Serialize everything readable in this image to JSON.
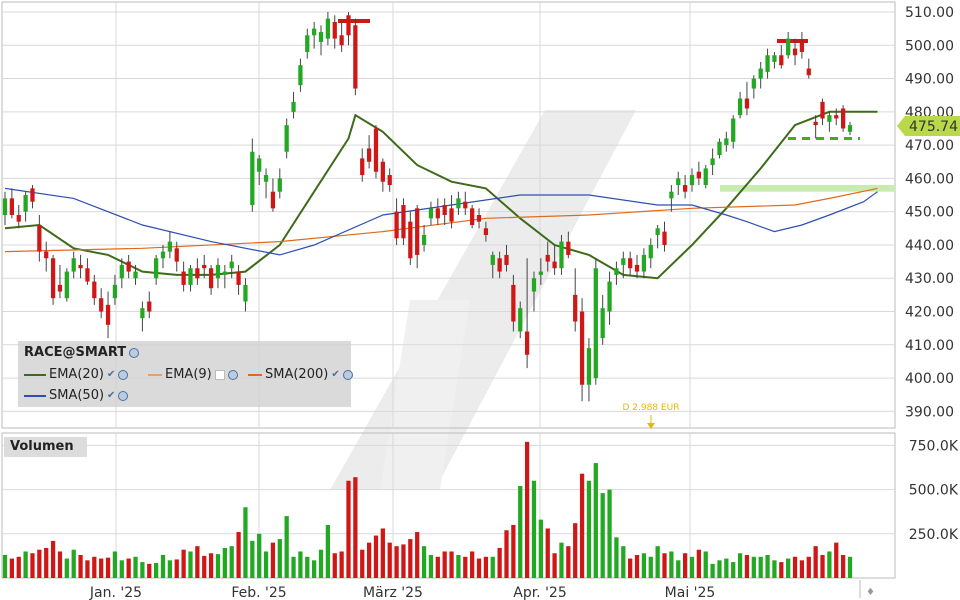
{
  "legend": {
    "title": "RACE@SMART",
    "items": [
      {
        "label": "EMA(20)",
        "color": "#3d6b1a"
      },
      {
        "label": "EMA(9)",
        "color": "#e0843a"
      },
      {
        "label": "SMA(200)",
        "color": "#e0843a"
      },
      {
        "label": "SMA(50)",
        "color": "#2f4fb0"
      }
    ]
  },
  "volume_panel": {
    "label": "Volumen"
  },
  "annotation": {
    "dividend": "D 2.988 EUR"
  },
  "last_price": "475.74",
  "colors": {
    "up": "#22a822",
    "down": "#d01717",
    "ema20": "#3d6b1a",
    "sma200": "#e06a1a",
    "sma50": "#2f4fb0",
    "grid": "#d9d9d9",
    "highlight": "#c8ecb0",
    "last_price_bg": "#b9d84a"
  },
  "chart_data": [
    {
      "type": "candlestick",
      "title": "RACE@SMART",
      "x_tick_labels": [
        "Jan. '25",
        "Feb. '25",
        "März '25",
        "Apr. '25",
        "Mai '25"
      ],
      "y_tick_labels": [
        "510.00",
        "500.00",
        "490.00",
        "480.00",
        "470.00",
        "460.00",
        "450.00",
        "440.00",
        "430.00",
        "420.00",
        "410.00",
        "400.00",
        "390.00"
      ],
      "ylim": [
        385,
        513
      ],
      "grid": true,
      "last_price": 475.74,
      "candles": [
        {
          "o": 449,
          "h": 456,
          "l": 446,
          "c": 454
        },
        {
          "o": 454,
          "h": 457,
          "l": 448,
          "c": 449
        },
        {
          "o": 449,
          "h": 452,
          "l": 445,
          "c": 447
        },
        {
          "o": 450,
          "h": 456,
          "l": 447,
          "c": 455
        },
        {
          "o": 457,
          "h": 458,
          "l": 451,
          "c": 453
        },
        {
          "o": 446,
          "h": 449,
          "l": 435,
          "c": 438
        },
        {
          "o": 438,
          "h": 441,
          "l": 432,
          "c": 436
        },
        {
          "o": 436,
          "h": 437,
          "l": 422,
          "c": 424
        },
        {
          "o": 428,
          "h": 434,
          "l": 424,
          "c": 426
        },
        {
          "o": 424,
          "h": 433,
          "l": 423,
          "c": 432
        },
        {
          "o": 432,
          "h": 438,
          "l": 430,
          "c": 436
        },
        {
          "o": 434,
          "h": 437,
          "l": 430,
          "c": 433
        },
        {
          "o": 433,
          "h": 436,
          "l": 428,
          "c": 429
        },
        {
          "o": 429,
          "h": 431,
          "l": 422,
          "c": 424
        },
        {
          "o": 424,
          "h": 427,
          "l": 418,
          "c": 420
        },
        {
          "o": 422,
          "h": 426,
          "l": 412,
          "c": 416
        },
        {
          "o": 424,
          "h": 431,
          "l": 422,
          "c": 428
        },
        {
          "o": 430,
          "h": 436,
          "l": 427,
          "c": 434
        },
        {
          "o": 435,
          "h": 437,
          "l": 430,
          "c": 432
        },
        {
          "o": 430,
          "h": 434,
          "l": 428,
          "c": 432
        },
        {
          "o": 418,
          "h": 423,
          "l": 414,
          "c": 421
        },
        {
          "o": 423,
          "h": 426,
          "l": 418,
          "c": 420
        },
        {
          "o": 430,
          "h": 437,
          "l": 428,
          "c": 436
        },
        {
          "o": 436,
          "h": 440,
          "l": 433,
          "c": 438
        },
        {
          "o": 438,
          "h": 444,
          "l": 436,
          "c": 441
        },
        {
          "o": 439,
          "h": 441,
          "l": 432,
          "c": 435
        },
        {
          "o": 432,
          "h": 435,
          "l": 426,
          "c": 428
        },
        {
          "o": 428,
          "h": 434,
          "l": 426,
          "c": 433
        },
        {
          "o": 433,
          "h": 436,
          "l": 428,
          "c": 430
        },
        {
          "o": 434,
          "h": 437,
          "l": 430,
          "c": 433
        },
        {
          "o": 433,
          "h": 434,
          "l": 425,
          "c": 427
        },
        {
          "o": 430,
          "h": 436,
          "l": 427,
          "c": 434
        },
        {
          "o": 431,
          "h": 434,
          "l": 427,
          "c": 432
        },
        {
          "o": 433,
          "h": 437,
          "l": 430,
          "c": 435
        },
        {
          "o": 432,
          "h": 434,
          "l": 425,
          "c": 428
        },
        {
          "o": 423,
          "h": 430,
          "l": 420,
          "c": 428
        },
        {
          "o": 452,
          "h": 472,
          "l": 450,
          "c": 468
        },
        {
          "o": 462,
          "h": 467,
          "l": 458,
          "c": 466
        },
        {
          "o": 459,
          "h": 463,
          "l": 454,
          "c": 461
        },
        {
          "o": 456,
          "h": 460,
          "l": 450,
          "c": 451
        },
        {
          "o": 456,
          "h": 463,
          "l": 454,
          "c": 460
        },
        {
          "o": 468,
          "h": 478,
          "l": 466,
          "c": 476
        },
        {
          "o": 480,
          "h": 486,
          "l": 478,
          "c": 483
        },
        {
          "o": 488,
          "h": 496,
          "l": 486,
          "c": 494
        },
        {
          "o": 498,
          "h": 505,
          "l": 496,
          "c": 503
        },
        {
          "o": 503,
          "h": 507,
          "l": 499,
          "c": 505
        },
        {
          "o": 501,
          "h": 506,
          "l": 497,
          "c": 504
        },
        {
          "o": 502,
          "h": 510,
          "l": 500,
          "c": 508
        },
        {
          "o": 507,
          "h": 509,
          "l": 499,
          "c": 502
        },
        {
          "o": 503,
          "h": 507,
          "l": 498,
          "c": 500
        },
        {
          "o": 509,
          "h": 510,
          "l": 500,
          "c": 503
        },
        {
          "o": 506,
          "h": 508,
          "l": 485,
          "c": 487
        },
        {
          "o": 466,
          "h": 469,
          "l": 459,
          "c": 461
        },
        {
          "o": 469,
          "h": 473,
          "l": 463,
          "c": 465
        },
        {
          "o": 475,
          "h": 476,
          "l": 460,
          "c": 462
        },
        {
          "o": 465,
          "h": 466,
          "l": 456,
          "c": 459
        },
        {
          "o": 461,
          "h": 463,
          "l": 456,
          "c": 458
        },
        {
          "o": 450,
          "h": 454,
          "l": 440,
          "c": 442
        },
        {
          "o": 452,
          "h": 454,
          "l": 440,
          "c": 442
        },
        {
          "o": 447,
          "h": 450,
          "l": 434,
          "c": 436
        },
        {
          "o": 451,
          "h": 452,
          "l": 433,
          "c": 437
        },
        {
          "o": 440,
          "h": 446,
          "l": 438,
          "c": 443
        },
        {
          "o": 448,
          "h": 453,
          "l": 446,
          "c": 451
        },
        {
          "o": 451,
          "h": 454,
          "l": 446,
          "c": 448
        },
        {
          "o": 452,
          "h": 454,
          "l": 446,
          "c": 449
        },
        {
          "o": 451,
          "h": 455,
          "l": 445,
          "c": 447
        },
        {
          "o": 451,
          "h": 456,
          "l": 449,
          "c": 454
        },
        {
          "o": 453,
          "h": 456,
          "l": 449,
          "c": 451
        },
        {
          "o": 451,
          "h": 452,
          "l": 445,
          "c": 446
        },
        {
          "o": 449,
          "h": 451,
          "l": 445,
          "c": 447
        },
        {
          "o": 445,
          "h": 447,
          "l": 441,
          "c": 443
        },
        {
          "o": 434,
          "h": 438,
          "l": 430,
          "c": 437
        },
        {
          "o": 436,
          "h": 438,
          "l": 430,
          "c": 432
        },
        {
          "o": 437,
          "h": 440,
          "l": 432,
          "c": 434
        },
        {
          "o": 428,
          "h": 431,
          "l": 414,
          "c": 417
        },
        {
          "o": 414,
          "h": 423,
          "l": 412,
          "c": 421
        },
        {
          "o": 414,
          "h": 436,
          "l": 403,
          "c": 407
        },
        {
          "o": 426,
          "h": 432,
          "l": 420,
          "c": 430
        },
        {
          "o": 431,
          "h": 436,
          "l": 428,
          "c": 432
        },
        {
          "o": 437,
          "h": 441,
          "l": 432,
          "c": 435
        },
        {
          "o": 435,
          "h": 440,
          "l": 431,
          "c": 433
        },
        {
          "o": 433,
          "h": 443,
          "l": 431,
          "c": 441
        },
        {
          "o": 441,
          "h": 444,
          "l": 436,
          "c": 437
        },
        {
          "o": 425,
          "h": 433,
          "l": 414,
          "c": 417
        },
        {
          "o": 420,
          "h": 424,
          "l": 393,
          "c": 398
        },
        {
          "o": 398,
          "h": 412,
          "l": 393,
          "c": 409
        },
        {
          "o": 400,
          "h": 436,
          "l": 398,
          "c": 433
        },
        {
          "o": 412,
          "h": 425,
          "l": 410,
          "c": 421
        },
        {
          "o": 420,
          "h": 432,
          "l": 416,
          "c": 429
        },
        {
          "o": 431,
          "h": 435,
          "l": 428,
          "c": 433
        },
        {
          "o": 434,
          "h": 438,
          "l": 430,
          "c": 436
        },
        {
          "o": 436,
          "h": 438,
          "l": 431,
          "c": 433
        },
        {
          "o": 434,
          "h": 437,
          "l": 430,
          "c": 432
        },
        {
          "o": 432,
          "h": 439,
          "l": 430,
          "c": 437
        },
        {
          "o": 436,
          "h": 442,
          "l": 433,
          "c": 440
        },
        {
          "o": 443,
          "h": 446,
          "l": 439,
          "c": 445
        },
        {
          "o": 444,
          "h": 447,
          "l": 438,
          "c": 440
        },
        {
          "o": 454,
          "h": 458,
          "l": 450,
          "c": 456
        },
        {
          "o": 458,
          "h": 462,
          "l": 455,
          "c": 460
        },
        {
          "o": 458,
          "h": 461,
          "l": 454,
          "c": 456
        },
        {
          "o": 458,
          "h": 463,
          "l": 456,
          "c": 461
        },
        {
          "o": 462,
          "h": 465,
          "l": 458,
          "c": 460
        },
        {
          "o": 458,
          "h": 464,
          "l": 457,
          "c": 463
        },
        {
          "o": 464,
          "h": 469,
          "l": 461,
          "c": 466
        },
        {
          "o": 467,
          "h": 472,
          "l": 466,
          "c": 471
        },
        {
          "o": 470,
          "h": 474,
          "l": 468,
          "c": 472
        },
        {
          "o": 471,
          "h": 479,
          "l": 469,
          "c": 478
        },
        {
          "o": 479,
          "h": 486,
          "l": 478,
          "c": 484
        },
        {
          "o": 484,
          "h": 489,
          "l": 479,
          "c": 481
        },
        {
          "o": 487,
          "h": 491,
          "l": 484,
          "c": 490
        },
        {
          "o": 490,
          "h": 495,
          "l": 487,
          "c": 493
        },
        {
          "o": 492,
          "h": 499,
          "l": 490,
          "c": 497
        },
        {
          "o": 495,
          "h": 498,
          "l": 493,
          "c": 497
        },
        {
          "o": 497,
          "h": 500,
          "l": 493,
          "c": 494
        },
        {
          "o": 497,
          "h": 504,
          "l": 496,
          "c": 502
        },
        {
          "o": 499,
          "h": 502,
          "l": 494,
          "c": 497
        },
        {
          "o": 501,
          "h": 504,
          "l": 496,
          "c": 498
        },
        {
          "o": 493,
          "h": 496,
          "l": 490,
          "c": 491
        },
        {
          "o": 477,
          "h": 479,
          "l": 472,
          "c": 476
        },
        {
          "o": 483,
          "h": 484,
          "l": 476,
          "c": 478
        },
        {
          "o": 477,
          "h": 480,
          "l": 474,
          "c": 479
        },
        {
          "o": 479,
          "h": 481,
          "l": 476,
          "c": 478
        },
        {
          "o": 481,
          "h": 482,
          "l": 474,
          "c": 475
        },
        {
          "o": 474,
          "h": 477,
          "l": 473,
          "c": 476
        }
      ],
      "series": [
        {
          "name": "EMA(20)",
          "values": [
            [
              0,
              445
            ],
            [
              5,
              446
            ],
            [
              10,
              439
            ],
            [
              15,
              437
            ],
            [
              20,
              432
            ],
            [
              25,
              431
            ],
            [
              30,
              431
            ],
            [
              35,
              432
            ],
            [
              40,
              440
            ],
            [
              45,
              456
            ],
            [
              50,
              472
            ],
            [
              51,
              479
            ],
            [
              55,
              474
            ],
            [
              60,
              464
            ],
            [
              65,
              459
            ],
            [
              70,
              457
            ],
            [
              75,
              448
            ],
            [
              80,
              440
            ],
            [
              85,
              437
            ],
            [
              90,
              431
            ],
            [
              95,
              430
            ],
            [
              100,
              440
            ],
            [
              105,
              451
            ],
            [
              110,
              463
            ],
            [
              115,
              476
            ],
            [
              120,
              480
            ],
            [
              125,
              480
            ],
            [
              127,
              480
            ]
          ]
        },
        {
          "name": "SMA(200)",
          "values": [
            [
              0,
              438
            ],
            [
              20,
              439
            ],
            [
              40,
              441
            ],
            [
              55,
              444
            ],
            [
              70,
              448
            ],
            [
              85,
              449
            ],
            [
              100,
              451
            ],
            [
              115,
              452
            ],
            [
              120,
              454
            ],
            [
              127,
              457
            ]
          ]
        },
        {
          "name": "SMA(50)",
          "values": [
            [
              0,
              457
            ],
            [
              10,
              454
            ],
            [
              20,
              446
            ],
            [
              30,
              441
            ],
            [
              40,
              437
            ],
            [
              45,
              440
            ],
            [
              55,
              449
            ],
            [
              65,
              452
            ],
            [
              75,
              455
            ],
            [
              85,
              455
            ],
            [
              95,
              452
            ],
            [
              100,
              452
            ],
            [
              105,
              449
            ],
            [
              108,
              447
            ],
            [
              112,
              444
            ],
            [
              116,
              446
            ],
            [
              120,
              449
            ],
            [
              125,
              453
            ],
            [
              127,
              456
            ]
          ]
        }
      ]
    },
    {
      "type": "bar",
      "title": "Volumen",
      "y_tick_labels": [
        "750.0K",
        "500.0K",
        "250.0K"
      ],
      "ylim": [
        0,
        820
      ],
      "colors_follow_candles": true,
      "values": [
        130,
        110,
        120,
        150,
        140,
        160,
        170,
        210,
        150,
        110,
        160,
        130,
        100,
        120,
        110,
        115,
        150,
        100,
        110,
        120,
        90,
        80,
        85,
        130,
        100,
        105,
        160,
        150,
        180,
        125,
        140,
        135,
        170,
        180,
        260,
        400,
        210,
        250,
        150,
        200,
        220,
        350,
        120,
        150,
        120,
        100,
        160,
        300,
        140,
        150,
        550,
        570,
        160,
        200,
        240,
        280,
        200,
        180,
        190,
        220,
        260,
        180,
        130,
        120,
        150,
        150,
        130,
        120,
        150,
        110,
        120,
        120,
        170,
        270,
        300,
        520,
        770,
        550,
        330,
        280,
        140,
        200,
        180,
        310,
        590,
        550,
        650,
        480,
        500,
        230,
        180,
        110,
        130,
        140,
        120,
        180,
        140,
        150,
        100,
        140,
        120,
        160,
        150,
        80,
        100,
        110,
        90,
        140,
        130,
        120,
        120,
        130,
        100,
        90,
        110,
        120,
        100,
        120,
        180,
        130,
        150,
        200,
        130,
        120,
        100,
        120,
        110
      ]
    }
  ]
}
